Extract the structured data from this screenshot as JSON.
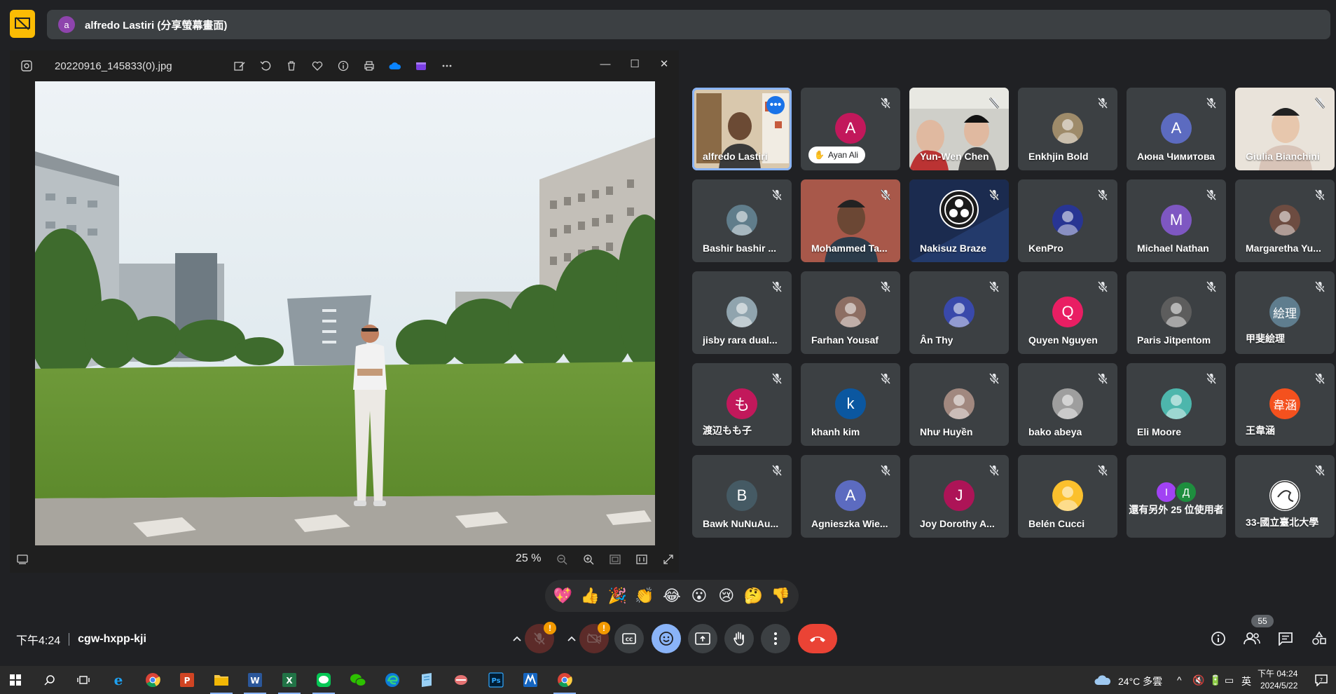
{
  "presenter": {
    "avatar_letter": "a",
    "title": "alfredo Lastiri (分享螢幕畫面)"
  },
  "photo_viewer": {
    "filename": "20220916_145833(0).jpg",
    "zoom": "25 %",
    "toolbar_icons": [
      "edit-icon",
      "rotate-icon",
      "delete-icon",
      "favorite-icon",
      "info-icon",
      "print-icon",
      "onedrive-icon",
      "clipchamp-icon",
      "more-icon"
    ]
  },
  "participants": [
    {
      "name": "alfredo Lastiri",
      "type": "video-self"
    },
    {
      "name": "Ayan Ali",
      "type": "letter",
      "letter": "A",
      "color": "#c2185b",
      "hand": true
    },
    {
      "name": "Yun-Wen Chen",
      "type": "video"
    },
    {
      "name": "Enkhjin Bold",
      "type": "photo",
      "color": "#9e8b6a"
    },
    {
      "name": "Аюна Чимитова",
      "type": "letter",
      "letter": "A",
      "color": "#5c6bc0"
    },
    {
      "name": "Giulia Bianchini",
      "type": "video"
    },
    {
      "name": "Bashir bashir ...",
      "type": "photo",
      "color": "#607d8b"
    },
    {
      "name": "Mohammed Ta...",
      "type": "video"
    },
    {
      "name": "Nakisuz Braze",
      "type": "obs"
    },
    {
      "name": "KenPro",
      "type": "photo",
      "color": "#283593"
    },
    {
      "name": "Michael Nathan",
      "type": "letter",
      "letter": "M",
      "color": "#7e57c2"
    },
    {
      "name": "Margaretha Yu...",
      "type": "photo",
      "color": "#6d4c41"
    },
    {
      "name": "jisby rara dual...",
      "type": "photo",
      "color": "#90a4ae"
    },
    {
      "name": "Farhan Yousaf",
      "type": "photo",
      "color": "#8d6e63"
    },
    {
      "name": "Ân Thy",
      "type": "photo",
      "color": "#3949ab"
    },
    {
      "name": "Quyen Nguyen",
      "type": "letter",
      "letter": "Q",
      "color": "#e91e63"
    },
    {
      "name": "Paris Jitpentom",
      "type": "photo",
      "color": "#5d5d5d"
    },
    {
      "name": "甲斐絵理",
      "type": "letter",
      "letter": "絵理",
      "color": "#5f7d8e"
    },
    {
      "name": "渡辺もも子",
      "type": "letter",
      "letter": "も",
      "color": "#c2185b"
    },
    {
      "name": "khanh kim",
      "type": "letter",
      "letter": "k",
      "color": "#0b57a0"
    },
    {
      "name": "Như Huyền",
      "type": "photo",
      "color": "#a1887f"
    },
    {
      "name": "bako abeya",
      "type": "photo",
      "color": "#9e9e9e"
    },
    {
      "name": "Eli Moore",
      "type": "photo",
      "color": "#4db6ac"
    },
    {
      "name": "王韋涵",
      "type": "letter",
      "letter": "韋涵",
      "color": "#f4511e"
    },
    {
      "name": "Bawk NuNuAu...",
      "type": "letter",
      "letter": "B",
      "color": "#455a64"
    },
    {
      "name": "Agnieszka Wie...",
      "type": "letter",
      "letter": "A",
      "color": "#5c6bc0"
    },
    {
      "name": "Joy Dorothy A...",
      "type": "letter",
      "letter": "J",
      "color": "#ad1457"
    },
    {
      "name": "Belén Cucci",
      "type": "photo",
      "color": "#fbc02d"
    },
    {
      "name": "還有另外 25 位使用者",
      "type": "others",
      "letters": [
        "I",
        "Д"
      ]
    },
    {
      "name": "33-國立臺北大學",
      "type": "logo"
    }
  ],
  "reactions": [
    "💖",
    "👍",
    "🎉",
    "👏",
    "😂",
    "😮",
    "😢",
    "🤔",
    "👎"
  ],
  "meeting": {
    "time": "下午4:24",
    "code": "cgw-hxpp-kji",
    "people_count": "55"
  },
  "taskbar": {
    "weather": "24°C 多雲",
    "ime": "英",
    "clock_time": "下午 04:24",
    "clock_date": "2024/5/22"
  }
}
